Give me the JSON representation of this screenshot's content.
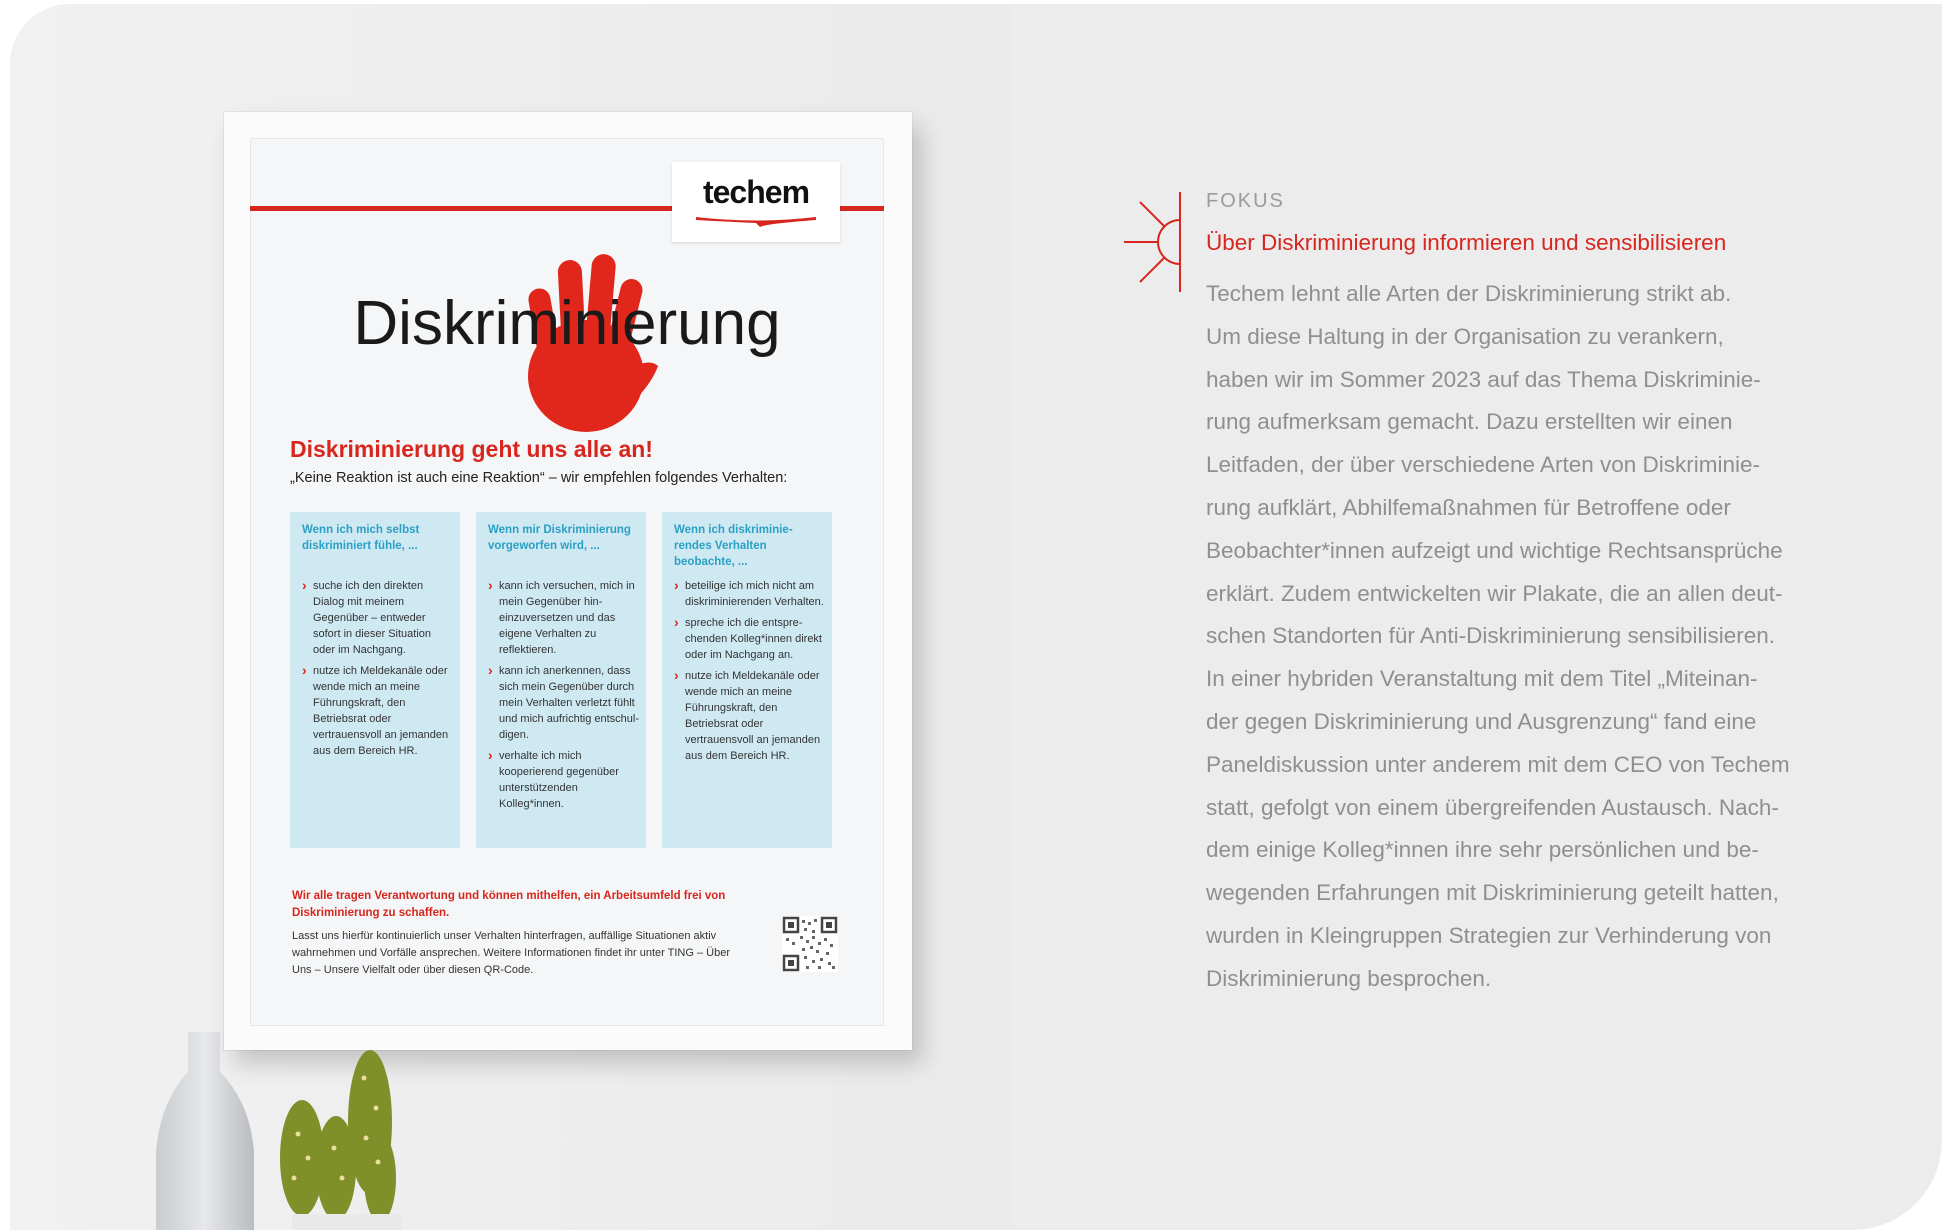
{
  "poster": {
    "logo": "techem",
    "big_word": "Diskriminierung",
    "headline": "Diskriminierung geht uns alle an!",
    "subline": "„Keine Reaktion ist auch eine Reaktion“ – wir empfehlen folgendes Verhalten:",
    "columns": [
      {
        "title": "Wenn ich mich selbst diskriminiert fühle, ...",
        "bullets": [
          "suche ich den direkten Dialog mit meinem Gegenüber – entweder sofort in dieser Situation oder im Nachgang.",
          "nutze ich Meldekanäle oder wende mich an meine Führungskraft, den Betriebsrat oder vertrauensvoll an jemanden aus dem Bereich HR."
        ]
      },
      {
        "title": "Wenn mir Diskrimi­nierung vorgeworfen wird, ...",
        "bullets": [
          "kann ich versuchen, mich in mein Gegenüber hin­einzuversetzen und das eigene Verhalten zu reflektieren.",
          "kann ich anerkennen, dass sich mein Gegen­über durch mein Ver­halten verletzt fühlt und mich aufrichtig entschul­digen.",
          "verhalte ich mich kooperierend gegenüber unterstützenden Kolleg*innen."
        ]
      },
      {
        "title": "Wenn ich diskriminie­rendes Verhalten beobachte, ...",
        "bullets": [
          "beteilige ich mich nicht am diskriminierenden Verhalten.",
          "spreche ich die entspre­chenden Kolleg*innen direkt oder im Nachgang an.",
          "nutze ich Meldekanäle oder wende mich an meine Führungskraft, den Betriebsrat oder vertrauensvoll an jemanden aus dem Bereich HR."
        ]
      }
    ],
    "footer_red": "Wir alle tragen Verantwortung und können mithelfen, ein Arbeitsumfeld frei von Diskriminierung zu schaffen.",
    "footer_text": "Lasst uns hierfür kontinuierlich unser Verhalten hinterfragen, auffällige Situa­tionen aktiv wahrnehmen und Vorfälle ansprechen. Weitere Informationen findet ihr unter TING – Über Uns – Unsere Vielfalt oder über diesen QR-Code."
  },
  "article": {
    "kicker": "FOKUS",
    "title": "Über Diskriminierung informieren und sensibilisieren",
    "lines": [
      "Techem lehnt alle Arten der Diskriminierung strikt ab.",
      "Um diese Haltung in der Organisation zu verankern,",
      "haben wir im Sommer 2023 auf das Thema Diskriminie-",
      "rung aufmerksam gemacht. Dazu erstellten wir einen",
      "Leitfaden, der über verschiedene Arten von Diskriminie-",
      "rung aufklärt, Abhilfemaßnahmen für Betroffene oder",
      "Beobachter*innen aufzeigt und wichtige Rechtsansprüche",
      "erklärt. Zudem entwickelten wir Plakate, die an allen deut-",
      "schen Standorten für Anti-Diskriminierung sensibilisieren.",
      "In einer hybriden Veranstaltung mit dem Titel „Miteinan-",
      "der gegen Diskriminierung und Ausgrenzung“ fand eine",
      "Paneldiskussion unter anderem mit dem CEO von Techem",
      "statt, gefolgt von einem übergreifenden Austausch. Nach-",
      "dem einige Kolleg*innen ihre sehr persönlichen und be-",
      "wegenden Erfahrungen mit Diskriminierung geteilt hatten,",
      "wurden in Kleingruppen Strategien zur Verhinderung von",
      "Diskriminierung besprochen."
    ]
  },
  "colors": {
    "accent_red": "#d7261e",
    "body_grey": "#8f8f8f",
    "kicker_grey": "#9b9b9b",
    "poster_column_blue": "#cfe9f3",
    "column_title_blue": "#2aa0c4"
  },
  "icons": [
    "focus-sun-icon",
    "stop-hand-icon",
    "qr-code-icon"
  ]
}
